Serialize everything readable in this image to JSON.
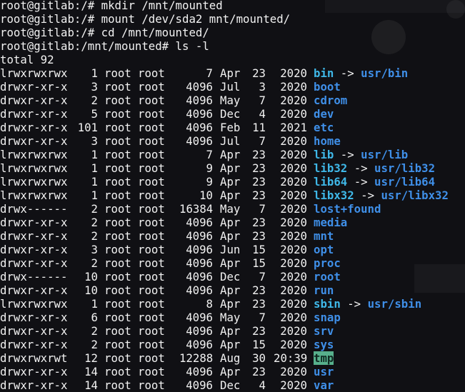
{
  "terminal": {
    "commands": [
      "root@gitlab:/# mkdir /mnt/mounted",
      "root@gitlab:/# mount /dev/sda2 mnt/mounted/",
      "root@gitlab:/# cd /mnt/mounted/",
      "root@gitlab:/mnt/mounted# ls -l"
    ],
    "total": "total 92",
    "entries": [
      {
        "perm": "lrwxrwxrwx",
        "links": "1",
        "owner": "root",
        "group": "root",
        "size": "7",
        "month": "Apr",
        "day": "23",
        "yt": "2020",
        "name": "bin",
        "arrow": "->",
        "target": "usr/bin",
        "kind": "link"
      },
      {
        "perm": "drwxr-xr-x",
        "links": "3",
        "owner": "root",
        "group": "root",
        "size": "4096",
        "month": "Jul",
        "day": "3",
        "yt": "2020",
        "name": "boot",
        "kind": "dir"
      },
      {
        "perm": "drwxr-xr-x",
        "links": "2",
        "owner": "root",
        "group": "root",
        "size": "4096",
        "month": "May",
        "day": "7",
        "yt": "2020",
        "name": "cdrom",
        "kind": "dir"
      },
      {
        "perm": "drwxr-xr-x",
        "links": "5",
        "owner": "root",
        "group": "root",
        "size": "4096",
        "month": "Dec",
        "day": "4",
        "yt": "2020",
        "name": "dev",
        "kind": "dir"
      },
      {
        "perm": "drwxr-xr-x",
        "links": "101",
        "owner": "root",
        "group": "root",
        "size": "4096",
        "month": "Feb",
        "day": "11",
        "yt": "2021",
        "name": "etc",
        "kind": "dir"
      },
      {
        "perm": "drwxr-xr-x",
        "links": "3",
        "owner": "root",
        "group": "root",
        "size": "4096",
        "month": "Jul",
        "day": "7",
        "yt": "2020",
        "name": "home",
        "kind": "dir"
      },
      {
        "perm": "lrwxrwxrwx",
        "links": "1",
        "owner": "root",
        "group": "root",
        "size": "7",
        "month": "Apr",
        "day": "23",
        "yt": "2020",
        "name": "lib",
        "arrow": "->",
        "target": "usr/lib",
        "kind": "link"
      },
      {
        "perm": "lrwxrwxrwx",
        "links": "1",
        "owner": "root",
        "group": "root",
        "size": "9",
        "month": "Apr",
        "day": "23",
        "yt": "2020",
        "name": "lib32",
        "arrow": "->",
        "target": "usr/lib32",
        "kind": "link"
      },
      {
        "perm": "lrwxrwxrwx",
        "links": "1",
        "owner": "root",
        "group": "root",
        "size": "9",
        "month": "Apr",
        "day": "23",
        "yt": "2020",
        "name": "lib64",
        "arrow": "->",
        "target": "usr/lib64",
        "kind": "link"
      },
      {
        "perm": "lrwxrwxrwx",
        "links": "1",
        "owner": "root",
        "group": "root",
        "size": "10",
        "month": "Apr",
        "day": "23",
        "yt": "2020",
        "name": "libx32",
        "arrow": "->",
        "target": "usr/libx32",
        "kind": "link"
      },
      {
        "perm": "drwx------",
        "links": "2",
        "owner": "root",
        "group": "root",
        "size": "16384",
        "month": "May",
        "day": "7",
        "yt": "2020",
        "name": "lost+found",
        "kind": "dir"
      },
      {
        "perm": "drwxr-xr-x",
        "links": "2",
        "owner": "root",
        "group": "root",
        "size": "4096",
        "month": "Apr",
        "day": "23",
        "yt": "2020",
        "name": "media",
        "kind": "dir"
      },
      {
        "perm": "drwxr-xr-x",
        "links": "2",
        "owner": "root",
        "group": "root",
        "size": "4096",
        "month": "Apr",
        "day": "23",
        "yt": "2020",
        "name": "mnt",
        "kind": "dir"
      },
      {
        "perm": "drwxr-xr-x",
        "links": "3",
        "owner": "root",
        "group": "root",
        "size": "4096",
        "month": "Jun",
        "day": "15",
        "yt": "2020",
        "name": "opt",
        "kind": "dir"
      },
      {
        "perm": "drwxr-xr-x",
        "links": "2",
        "owner": "root",
        "group": "root",
        "size": "4096",
        "month": "Apr",
        "day": "15",
        "yt": "2020",
        "name": "proc",
        "kind": "dir"
      },
      {
        "perm": "drwx------",
        "links": "10",
        "owner": "root",
        "group": "root",
        "size": "4096",
        "month": "Dec",
        "day": "7",
        "yt": "2020",
        "name": "root",
        "kind": "dir"
      },
      {
        "perm": "drwxr-xr-x",
        "links": "10",
        "owner": "root",
        "group": "root",
        "size": "4096",
        "month": "Apr",
        "day": "23",
        "yt": "2020",
        "name": "run",
        "kind": "dir"
      },
      {
        "perm": "lrwxrwxrwx",
        "links": "1",
        "owner": "root",
        "group": "root",
        "size": "8",
        "month": "Apr",
        "day": "23",
        "yt": "2020",
        "name": "sbin",
        "arrow": "->",
        "target": "usr/sbin",
        "kind": "link"
      },
      {
        "perm": "drwxr-xr-x",
        "links": "6",
        "owner": "root",
        "group": "root",
        "size": "4096",
        "month": "May",
        "day": "7",
        "yt": "2020",
        "name": "snap",
        "kind": "dir"
      },
      {
        "perm": "drwxr-xr-x",
        "links": "2",
        "owner": "root",
        "group": "root",
        "size": "4096",
        "month": "Apr",
        "day": "23",
        "yt": "2020",
        "name": "srv",
        "kind": "dir"
      },
      {
        "perm": "drwxr-xr-x",
        "links": "2",
        "owner": "root",
        "group": "root",
        "size": "4096",
        "month": "Apr",
        "day": "15",
        "yt": "2020",
        "name": "sys",
        "kind": "dir"
      },
      {
        "perm": "drwxrwxrwt",
        "links": "12",
        "owner": "root",
        "group": "root",
        "size": "12288",
        "month": "Aug",
        "day": "30",
        "yt": "20:39",
        "name": "tmp",
        "kind": "sticky"
      },
      {
        "perm": "drwxr-xr-x",
        "links": "14",
        "owner": "root",
        "group": "root",
        "size": "4096",
        "month": "Apr",
        "day": "23",
        "yt": "2020",
        "name": "usr",
        "kind": "dir"
      },
      {
        "perm": "drwxr-xr-x",
        "links": "14",
        "owner": "root",
        "group": "root",
        "size": "4096",
        "month": "Dec",
        "day": "4",
        "yt": "2020",
        "name": "var",
        "kind": "dir"
      }
    ]
  },
  "colors": {
    "background": "#101014",
    "text": "#f2f2f2",
    "directory": "#3f8fe8",
    "symlink": "#3fb8e8",
    "sticky_bg": "#57b08c"
  }
}
